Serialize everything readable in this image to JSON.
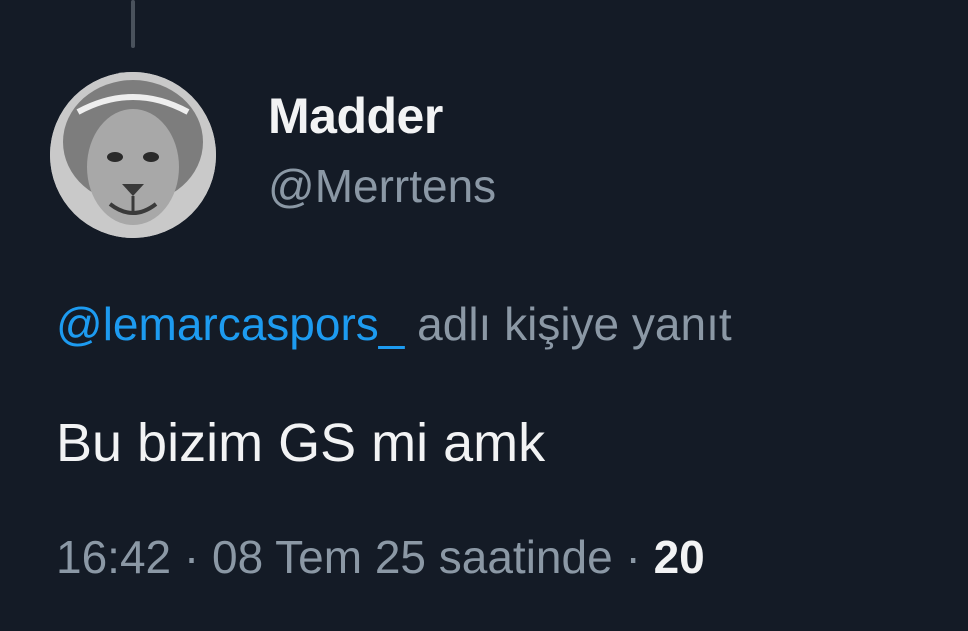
{
  "tweet": {
    "author": {
      "display_name": "Madder",
      "handle": "@Merrtens",
      "avatar": "lion-avatar"
    },
    "reply_to": {
      "mention": "@lemarcaspors_",
      "suffix": " adlı kişiye yanıt"
    },
    "text": "Bu bizim GS mi amk",
    "meta": {
      "time": "16:42",
      "separator": " · ",
      "date": "08 Tem 25 saatinde",
      "count": "20"
    }
  },
  "colors": {
    "background": "#141b26",
    "mention": "#1d9bf0",
    "secondary_text": "#8b98a5",
    "primary_text": "#f2f3f4"
  }
}
